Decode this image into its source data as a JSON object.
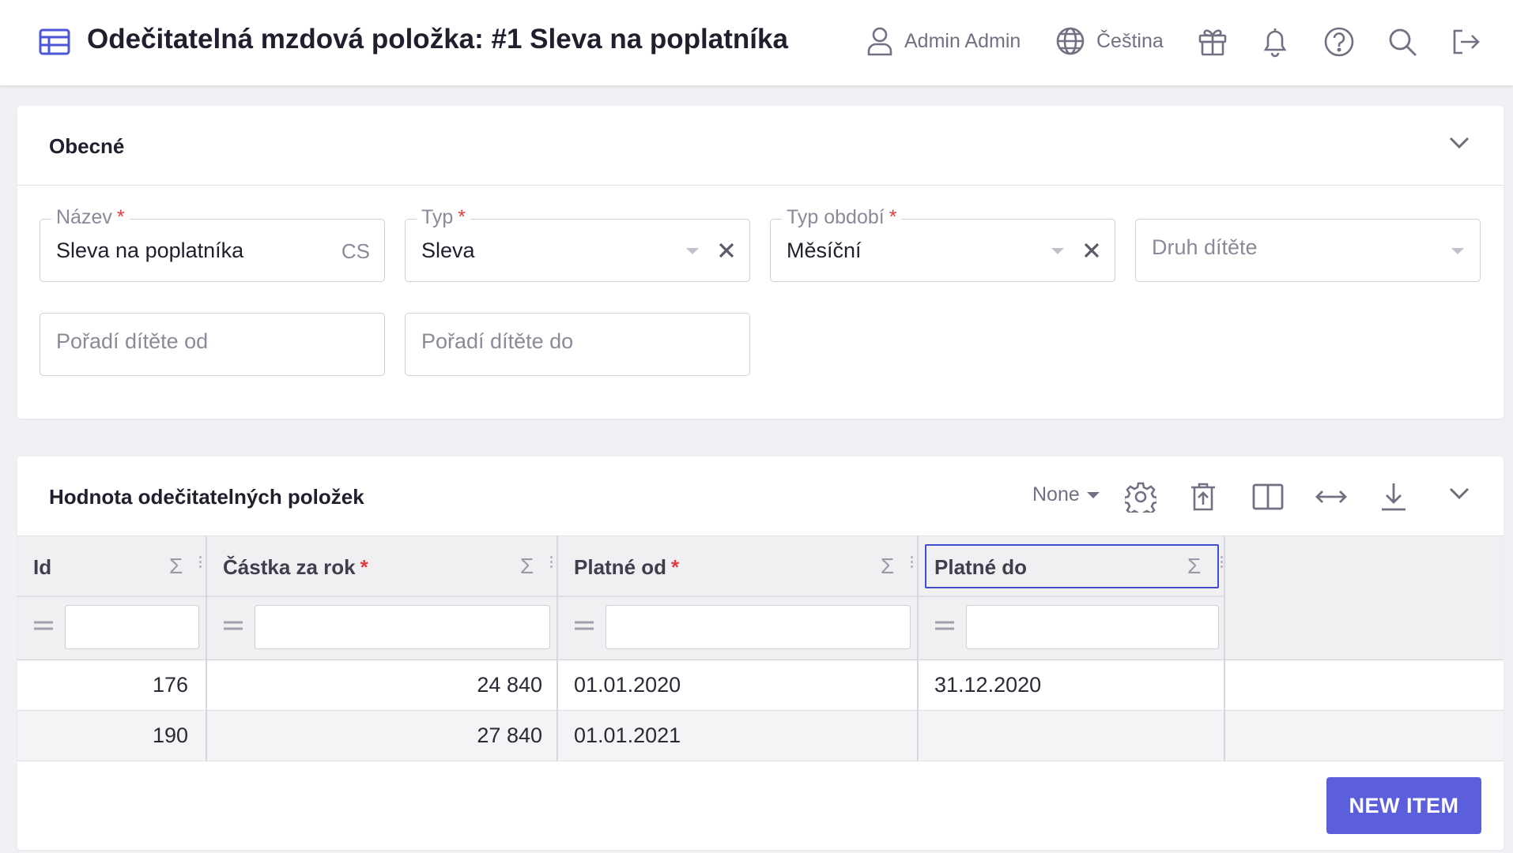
{
  "header": {
    "title": "Odečitatelná mzdová položka: #1 Sleva na poplatníka",
    "user": "Admin Admin",
    "language": "Čeština",
    "icons": [
      "table-icon",
      "user-icon",
      "globe-icon",
      "gift-icon",
      "bell-icon",
      "help-icon",
      "search-icon",
      "logout-icon"
    ]
  },
  "general": {
    "title": "Obecné",
    "fields": {
      "name": {
        "label": "Název",
        "required": "*",
        "value": "Sleva na poplatníka",
        "lang": "CS"
      },
      "type": {
        "label": "Typ",
        "required": "*",
        "value": "Sleva"
      },
      "period": {
        "label": "Typ období",
        "required": "*",
        "value": "Měsíční"
      },
      "child_kind": {
        "placeholder": "Druh dítěte"
      },
      "child_order_from": {
        "placeholder": "Pořadí dítěte od"
      },
      "child_order_to": {
        "placeholder": "Pořadí dítěte do"
      }
    }
  },
  "values": {
    "title": "Hodnota odečitatelných položek",
    "grouping": "None",
    "columns": [
      {
        "label": "Id",
        "required": ""
      },
      {
        "label": "Částka za rok",
        "required": "*"
      },
      {
        "label": "Platné od",
        "required": "*"
      },
      {
        "label": "Platné do",
        "required": ""
      }
    ],
    "sigma": "Σ",
    "rows": [
      {
        "id": "176",
        "amount": "24 840",
        "from": "01.01.2020",
        "to": "31.12.2020"
      },
      {
        "id": "190",
        "amount": "27 840",
        "from": "01.01.2021",
        "to": ""
      }
    ],
    "new_item": "NEW ITEM"
  },
  "colors": {
    "accent": "#5b5fdc",
    "focus": "#3d4fcf",
    "required": "#e03e3e",
    "muted": "#717183"
  }
}
